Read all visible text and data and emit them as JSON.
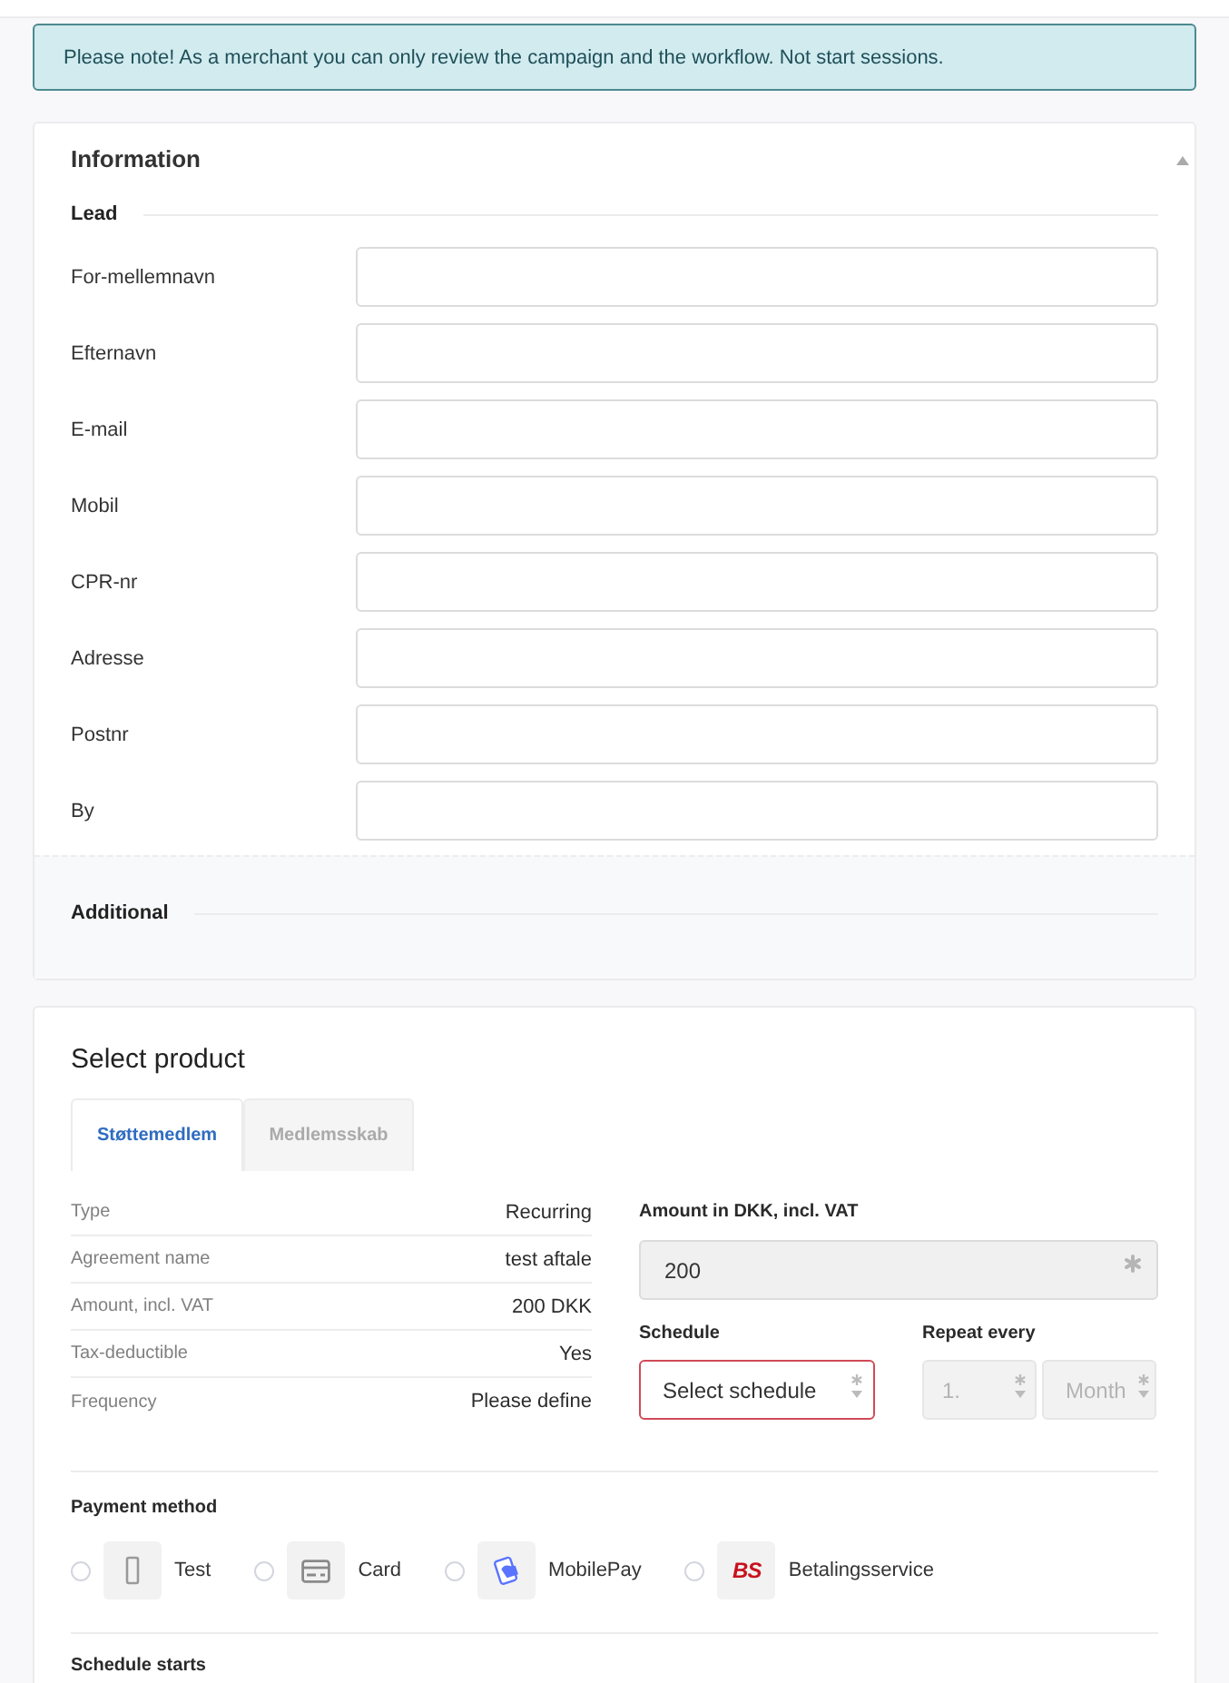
{
  "notice": {
    "text": "Please note! As a merchant you can only review the campaign and the workflow. Not start sessions."
  },
  "information": {
    "title": "Information",
    "expanded": true,
    "lead": {
      "title": "Lead",
      "fields": [
        {
          "label": "For-mellemnavn"
        },
        {
          "label": "Efternavn"
        },
        {
          "label": "E-mail"
        },
        {
          "label": "Mobil"
        },
        {
          "label": "CPR-nr"
        },
        {
          "label": "Adresse"
        },
        {
          "label": "Postnr"
        },
        {
          "label": "By"
        }
      ]
    },
    "additional": {
      "title": "Additional"
    }
  },
  "product": {
    "title": "Select product",
    "tabs": [
      {
        "label": "Støttemedlem",
        "selected": true
      },
      {
        "label": "Medlemsskab",
        "selected": false
      }
    ],
    "details": [
      {
        "label": "Type",
        "value": "Recurring"
      },
      {
        "label": "Agreement name",
        "value": "test aftale"
      },
      {
        "label": "Amount, incl. VAT",
        "value": "200 DKK"
      },
      {
        "label": "Tax-deductible",
        "value": "Yes"
      },
      {
        "label": "Frequency",
        "value": "Please define"
      }
    ],
    "amount": {
      "label": "Amount in DKK, incl. VAT",
      "value": "200",
      "readonly": true,
      "required": true
    },
    "schedule": {
      "label": "Schedule",
      "value": "Select schedule",
      "required": true,
      "invalid": true
    },
    "repeat": {
      "label": "Repeat every",
      "disabled": true,
      "count": {
        "value": "1.",
        "required": true
      },
      "unit": {
        "value": "Month",
        "required": true
      }
    },
    "payment": {
      "title": "Payment method",
      "options": [
        {
          "kind": "phone",
          "label": "Test",
          "selected": false
        },
        {
          "kind": "card",
          "label": "Card",
          "selected": false
        },
        {
          "kind": "mobilepay",
          "label": "MobilePay",
          "selected": false
        },
        {
          "kind": "bs",
          "logo_text": "BS",
          "label": "Betalingsservice",
          "selected": false
        }
      ]
    },
    "schedule_starts": {
      "title": "Schedule starts"
    }
  }
}
